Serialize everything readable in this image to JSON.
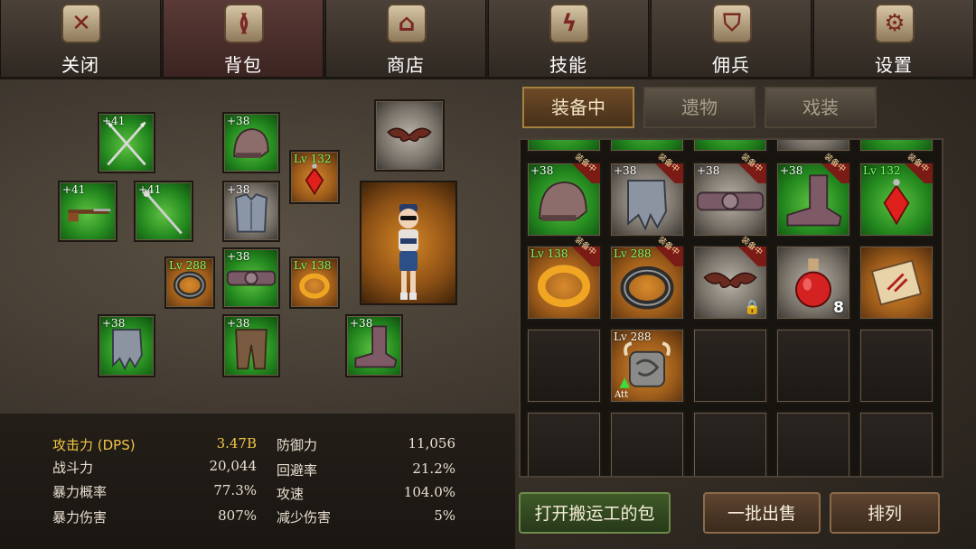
{
  "nav": {
    "tabs": [
      {
        "label": "关闭",
        "icon": "close-icon",
        "glyph": "✕",
        "active": false
      },
      {
        "label": "背包",
        "icon": "backpack-icon",
        "glyph": "≬",
        "active": true
      },
      {
        "label": "商店",
        "icon": "shop-icon",
        "glyph": "⌂",
        "active": false
      },
      {
        "label": "技能",
        "icon": "lightning-icon",
        "glyph": "ϟ",
        "active": false
      },
      {
        "label": "佣兵",
        "icon": "shield-icon",
        "glyph": "⛉",
        "active": false
      },
      {
        "label": "设置",
        "icon": "gear-icon",
        "glyph": "⚙",
        "active": false
      }
    ]
  },
  "equipped": {
    "spears": "+41",
    "rifle": "+41",
    "staff": "+41",
    "helmet": "+38",
    "armor": "+38",
    "amulet": "Lv 132",
    "ring1": "Lv 288",
    "belt": "+38",
    "ring2": "Lv 138",
    "gloves": "+38",
    "pants": "+38",
    "boots": "+38"
  },
  "inventory": {
    "tabs": [
      "装备中",
      "遗物",
      "戏装"
    ],
    "equipped_tag": "装备中",
    "items": [
      {
        "name": "helmet",
        "tag": "+38"
      },
      {
        "name": "gloves",
        "tag": "+38"
      },
      {
        "name": "belt",
        "tag": "+38"
      },
      {
        "name": "boots",
        "tag": "+38"
      },
      {
        "name": "amulet",
        "tag": "Lv 132"
      },
      {
        "name": "ring-gold",
        "tag": "Lv 138"
      },
      {
        "name": "ring-dark",
        "tag": "Lv 288"
      },
      {
        "name": "bat-wings",
        "tag": ""
      },
      {
        "name": "potion",
        "tag": "",
        "count": "8"
      },
      {
        "name": "scroll",
        "tag": ""
      },
      {
        "name": "horn-rune",
        "tag": "Lv 288",
        "sub": "Att"
      }
    ]
  },
  "stats": {
    "left": [
      {
        "label": "攻击力 (DPS)",
        "value": "3.47B",
        "highlight": true
      },
      {
        "label": "战斗力",
        "value": "20,044"
      },
      {
        "label": "暴力概率",
        "value": "77.3%"
      },
      {
        "label": "暴力伤害",
        "value": "807%"
      }
    ],
    "right": [
      {
        "label": "防御力",
        "value": "11,056"
      },
      {
        "label": "回避率",
        "value": "21.2%"
      },
      {
        "label": "攻速",
        "value": "104.0%"
      },
      {
        "label": "减少伤害",
        "value": "5%"
      }
    ]
  },
  "buttons": {
    "porter": "打开搬运工的包",
    "bulk_sell": "一批出售",
    "sort": "排列"
  },
  "colors": {
    "highlight": "#f3c645",
    "level_green": "#7cff6a",
    "active_tab": "#a7813e"
  }
}
